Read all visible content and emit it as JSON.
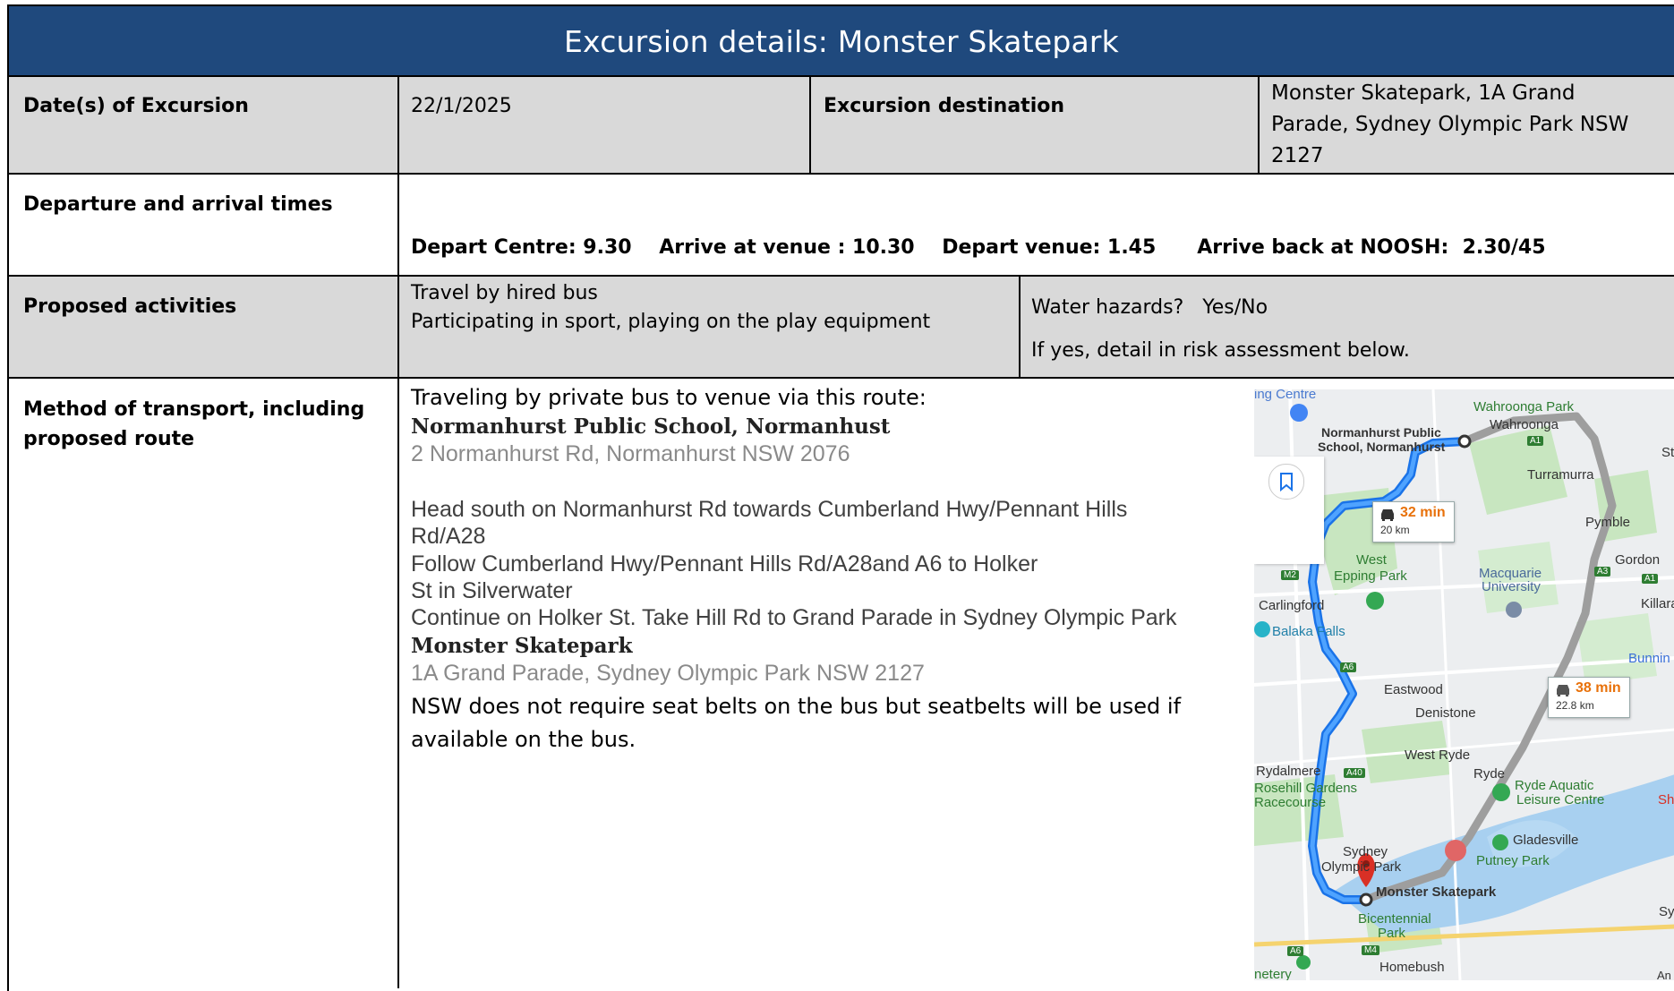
{
  "header": {
    "title": "Excursion details: Monster Skatepark"
  },
  "row1": {
    "date_label": "Date(s) of Excursion",
    "date_value": "22/1/2025",
    "dest_label": "Excursion destination",
    "dest_line1": "Monster Skatepark, 1A Grand",
    "dest_line2": "Parade, Sydney Olympic Park NSW",
    "dest_line3": "2127"
  },
  "row2": {
    "label": "Departure and arrival times",
    "times": "Depart Centre: 9.30    Arrive at venue : 10.30    Depart venue: 1.45      Arrive back at NOOSH:  2.30/45"
  },
  "row3": {
    "label": "Proposed activities",
    "activity1": "Travel by hired bus",
    "activity2": "Participating in sport, playing on the play equipment",
    "water": "Water hazards?   Yes/No",
    "water_note": "If yes, detail in risk assessment below."
  },
  "row4": {
    "label_line1": "Method of transport, including",
    "label_line2": "proposed route",
    "intro": "Traveling by private bus to venue via this route:",
    "origin_name": "Normanhurst Public School, Normanhust",
    "origin_addr": "2 Normanhurst Rd, Normanhurst NSW 2076",
    "step1a": "Head south on Normanhurst Rd towards Cumberland Hwy/Pennant Hills",
    "step1b": "Rd/A28",
    "step2a": "Follow Cumberland Hwy/Pennant Hills Rd/A28and A6 to Holker",
    "step2b": "St in Silverwater",
    "step3": "Continue on Holker St. Take Hill Rd to Grand Parade in Sydney Olympic Park",
    "dest_name": "Monster Skatepark",
    "dest_addr": "1A Grand Parade, Sydney Olympic Park NSW 2127",
    "note1": "NSW does not require seat belts on the bus but seatbelts will be used if",
    "note2": "available on the bus."
  },
  "map": {
    "labels": {
      "centre": "ing Centre",
      "wahroonga_park": "Wahroonga Park",
      "wahroonga": "Wahroonga",
      "school1": "Normanhurst Public",
      "school2": "School, Normanhurst",
      "turramurra": "Turramurra",
      "st": "St",
      "pymble": "Pymble",
      "gordon": "Gordon",
      "west_epping1": "West",
      "west_epping2": "Epping Park",
      "macquarie1": "Macquarie",
      "macquarie2": "University",
      "killara": "Killara",
      "carlingford": "Carlingford",
      "balaka": "Balaka Falls",
      "bunnings": "Bunnin",
      "eastwood": "Eastwood",
      "denistone": "Denistone",
      "west_ryde": "West Ryde",
      "ryde": "Ryde",
      "rydalmere": "Rydalmere",
      "rosehill1": "Rosehill Gardens",
      "rosehill2": "Racecourse",
      "ryde_aquatic1": "Ryde Aquatic",
      "ryde_aquatic2": "Leisure Centre",
      "sho": "Sho",
      "gladesville": "Gladesville",
      "putney": "Putney Park",
      "sydney_olympic1": "Sydney",
      "sydney_olympic2": "Olympic Park",
      "monster": "Monster Skatepark",
      "bicentennial1": "Bicentennial",
      "bicentennial2": "Park",
      "homebush": "Homebush",
      "sy": "Sy",
      "cemetery": "netery",
      "a1": "A1",
      "a3": "A3",
      "a6": "A6",
      "a40": "A40",
      "m2": "M2",
      "m4": "M4",
      "an": "An"
    },
    "route_main": {
      "time": "32 min",
      "dist": "20 km"
    },
    "route_alt": {
      "time": "38 min",
      "dist": "22.8 km"
    },
    "colors": {
      "route": "#4285f4",
      "alt_route": "#9e9e9e",
      "time": "#e8710a",
      "water": "#a8d0f0",
      "park": "#c8e6c0"
    }
  }
}
